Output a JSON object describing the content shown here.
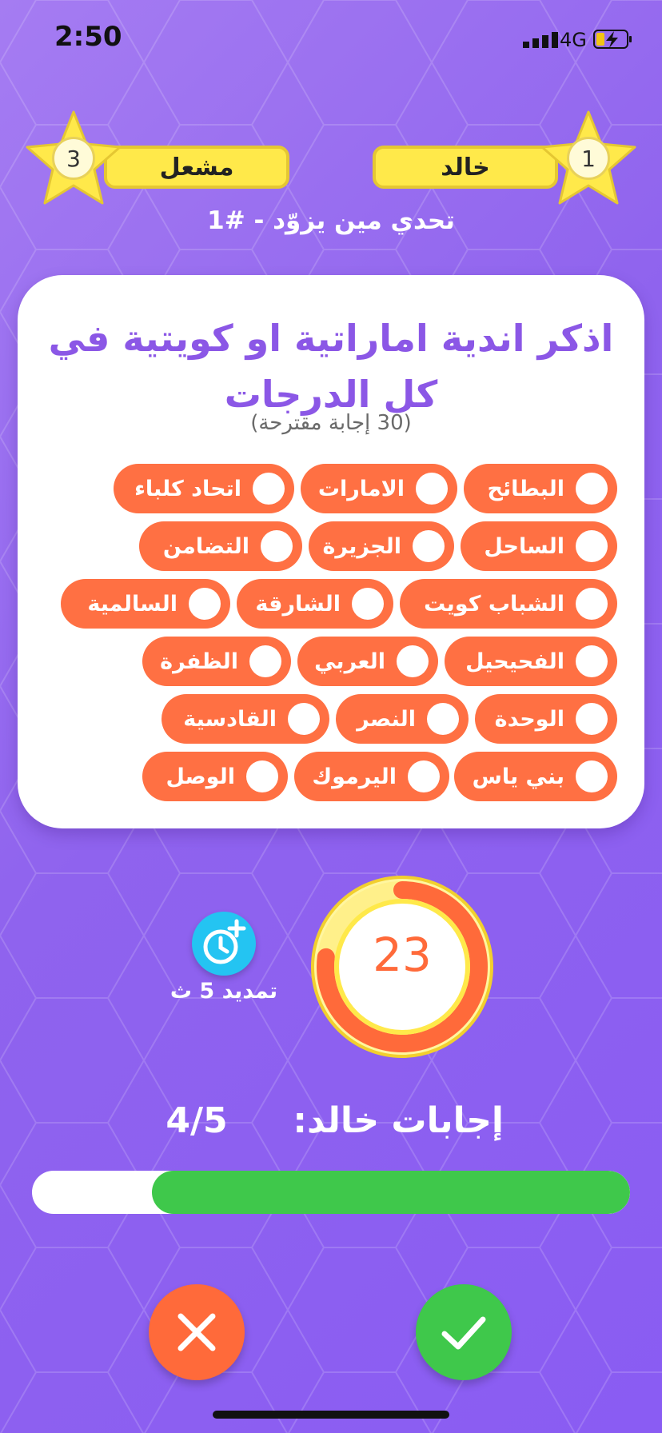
{
  "status_bar": {
    "time": "2:50",
    "network": "4G"
  },
  "players": {
    "left": {
      "name": "مشعل",
      "rank": "3"
    },
    "right": {
      "name": "خالد",
      "rank": "1"
    }
  },
  "challenge_title": "تحدي مين يزوّد - #1",
  "question": {
    "text": "اذكر اندية اماراتية او كويتية في كل الدرجات",
    "subtitle": "(30 إجابة مقترحة)",
    "answers": [
      "البطائح",
      "الامارات",
      "اتحاد كلباء",
      "الساحل",
      "الجزيرة",
      "التضامن",
      "الشباب كويت",
      "الشارقة",
      "السالمية",
      "الفحيحيل",
      "العربي",
      "الظفرة",
      "الوحدة",
      "النصر",
      "القادسية",
      "بني ياس",
      "اليرموك",
      "الوصل"
    ]
  },
  "extend": {
    "label": "تمديد 5 ث",
    "icon": "clock-plus-icon"
  },
  "timer": {
    "seconds": "23",
    "remaining_fraction": 0.77
  },
  "player_answers": {
    "label": "إجابات خالد:",
    "count": "4/5",
    "progress_fraction": 0.8
  },
  "colors": {
    "accent_orange": "#ff7043",
    "green": "#3fc84b",
    "yellow": "#ffe94a",
    "purple_text": "#8b57e6",
    "cyan": "#24c4f2"
  }
}
